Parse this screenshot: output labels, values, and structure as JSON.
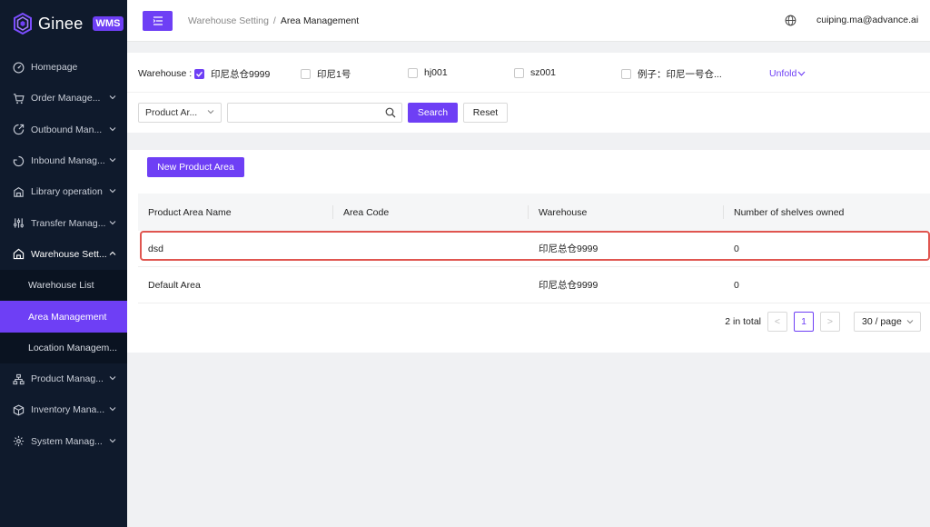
{
  "brand": {
    "name": "Ginee",
    "badge": "WMS"
  },
  "sidebar": {
    "items": [
      {
        "label": "Homepage",
        "icon": "speedometer-icon",
        "has_chevron": false
      },
      {
        "label": "Order Manage...",
        "icon": "cart-icon",
        "has_chevron": true
      },
      {
        "label": "Outbound Man...",
        "icon": "outbound-icon",
        "has_chevron": true
      },
      {
        "label": "Inbound Manag...",
        "icon": "inbound-icon",
        "has_chevron": true
      },
      {
        "label": "Library operation",
        "icon": "library-icon",
        "has_chevron": true
      },
      {
        "label": "Transfer Manag...",
        "icon": "transfer-icon",
        "has_chevron": true
      },
      {
        "label": "Warehouse Sett...",
        "icon": "warehouse-icon",
        "has_chevron": true,
        "open": true
      },
      {
        "label": "Product Manag...",
        "icon": "product-icon",
        "has_chevron": true
      },
      {
        "label": "Inventory Mana...",
        "icon": "inventory-icon",
        "has_chevron": true
      },
      {
        "label": "System Manag...",
        "icon": "system-icon",
        "has_chevron": true
      }
    ],
    "submenu": [
      {
        "label": "Warehouse List",
        "active": false
      },
      {
        "label": "Area Management",
        "active": true
      },
      {
        "label": "Location Managem...",
        "active": false
      }
    ]
  },
  "header": {
    "breadcrumb_parent": "Warehouse Setting",
    "breadcrumb_sep": "/",
    "breadcrumb_current": "Area Management",
    "user": "cuiping.ma@advance.ai"
  },
  "filters": {
    "warehouse_label": "Warehouse :",
    "warehouses": [
      {
        "label": "印尼总仓9999",
        "checked": true
      },
      {
        "label": "印尼1号",
        "checked": false
      },
      {
        "label": "hj001",
        "checked": false
      },
      {
        "label": "sz001",
        "checked": false
      },
      {
        "label": "例子：印尼一号仓...",
        "checked": false
      }
    ],
    "unfold": "Unfold",
    "field_select": "Product Ar...",
    "search_value": "",
    "search_button": "Search",
    "reset_button": "Reset"
  },
  "table": {
    "new_button": "New Product Area",
    "columns": [
      "Product Area Name",
      "Area Code",
      "Warehouse",
      "Number of shelves owned"
    ],
    "rows": [
      [
        "dsd",
        "",
        "印尼总仓9999",
        "0"
      ],
      [
        "Default Area",
        "",
        "印尼总仓9999",
        "0"
      ]
    ]
  },
  "pagination": {
    "total": "2 in total",
    "prev": "<",
    "page": "1",
    "next": ">",
    "page_size": "30 / page"
  },
  "colors": {
    "accent": "#6e3ff5",
    "sidebar": "#0f1a2c",
    "highlight": "#e05650"
  }
}
